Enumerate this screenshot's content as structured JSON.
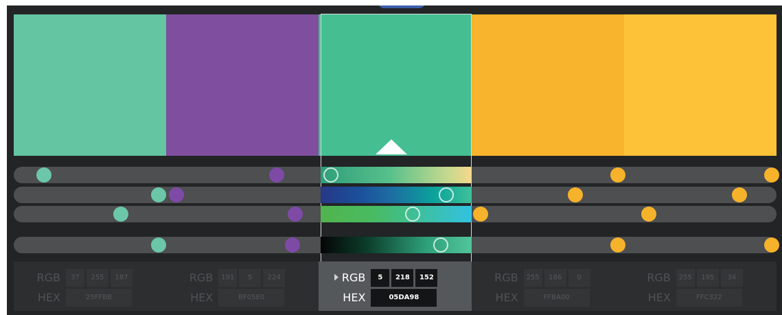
{
  "palette": {
    "selected_index": 2,
    "swatches": [
      {
        "hex_label": "25FFBB",
        "fill": "#64c5a2",
        "rgb": [
          "37",
          "255",
          "187"
        ],
        "knobs": [
          0.04,
          0.19,
          0.14,
          0.19
        ],
        "knob_color": "#6bc7a8"
      },
      {
        "hex_label": "BF05E0",
        "fill": "#7f4e9e",
        "rgb": [
          "191",
          "5",
          "224"
        ],
        "knobs": [
          0.345,
          0.213,
          0.369,
          0.365
        ],
        "knob_color": "#7e4aa6"
      },
      {
        "hex_label": "05DA98",
        "fill": "#45be92",
        "rgb": [
          "5",
          "218",
          "152"
        ],
        "knobs": [
          0.416,
          0.567,
          0.523,
          0.56
        ],
        "knob_color": "#45be92"
      },
      {
        "hex_label": "FFBA00",
        "fill": "#f8b42c",
        "rgb": [
          "255",
          "186",
          "0"
        ],
        "knobs": [
          0.792,
          0.736,
          0.612,
          0.792
        ],
        "knob_color": "#f6b22a"
      },
      {
        "hex_label": "FFC322",
        "fill": "#fdc237",
        "rgb": [
          "255",
          "195",
          "34"
        ],
        "knobs": [
          0.994,
          0.951,
          0.833,
          0.994
        ],
        "knob_color": "#f6b22a"
      }
    ]
  },
  "labels": {
    "rgb": "RGB",
    "hex": "HEX"
  },
  "sliders": {
    "gradients": [
      "linear-gradient(90deg, #2f9e79 0%, #56c08c 45%, #c8d98f 85%, #f5d88a 100%)",
      "linear-gradient(90deg, #273887 0%, #1b4f9a 25%, #1e6aa3 45%, #0aa39a 75%, #3fc09a 100%)",
      "linear-gradient(90deg, #52b44d 0%, #48bb62 35%, #3cc0a6 70%, #32c2e2 100%)",
      "linear-gradient(90deg, #050505 0%, #0b3c2a 30%, #2ea07a 70%, #52c59b 100%)"
    ]
  }
}
